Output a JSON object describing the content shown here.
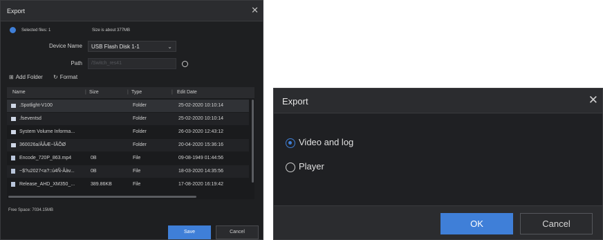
{
  "left_dialog": {
    "title": "Export",
    "selected_files": "Selected files: 1",
    "size_info": "Size is about 377MB",
    "device_name_label": "Device Name",
    "device_name_value": "USB Flash Disk 1-1",
    "path_label": "Path",
    "path_placeholder": "/Switch_res41",
    "add_folder_label": "Add Folder",
    "format_label": "Format",
    "columns": [
      "Name",
      "Size",
      "Type",
      "Edit Date"
    ],
    "rows": [
      {
        "name": ".Spotlight-V100",
        "size": "",
        "type": "Folder",
        "date": "25-02-2020 10:10:14",
        "kind": "folder"
      },
      {
        "name": ".fseventsd",
        "size": "",
        "type": "Folder",
        "date": "25-02-2020 10:10:14",
        "kind": "folder"
      },
      {
        "name": "System Volume Informa...",
        "size": "",
        "type": "Folder",
        "date": "26-03-2020 12:43:12",
        "kind": "folder"
      },
      {
        "name": "360026a/ÂÂÆ~ÏÂÕØ",
        "size": "",
        "type": "Folder",
        "date": "20-04-2020 15:36:16",
        "kind": "folder"
      },
      {
        "name": "Encode_720P_863.mp4",
        "size": "0B",
        "type": "File",
        "date": "09-08-1949 01:44:56",
        "kind": "file"
      },
      {
        "name": "~$?u2027<a?::ú4Ñ-Âàv...",
        "size": "0B",
        "type": "File",
        "date": "18-03-2020 14:35:56",
        "kind": "file"
      },
      {
        "name": "Release_AHD_XM350_...",
        "size": "389.86KB",
        "type": "File",
        "date": "17-08-2020 16:19:42",
        "kind": "file"
      }
    ],
    "free_space": "Free Space: 7034.15MB",
    "save_label": "Save",
    "cancel_label": "Cancel",
    "accent": "#3f7fd8"
  },
  "right_dialog": {
    "title": "Export",
    "options": [
      {
        "label": "Video and log",
        "selected": true
      },
      {
        "label": "Player",
        "selected": false
      }
    ],
    "ok_label": "OK",
    "cancel_label": "Cancel"
  }
}
